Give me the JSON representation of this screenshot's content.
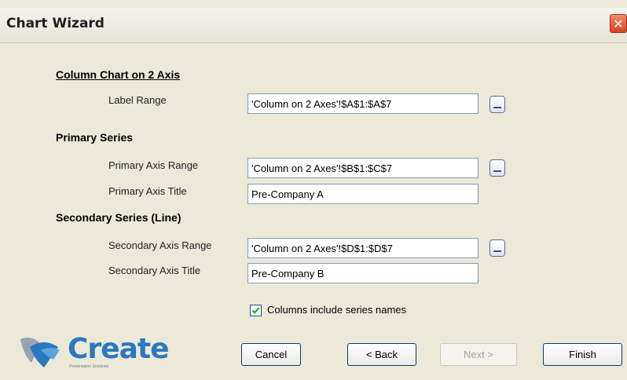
{
  "window": {
    "title": "Chart Wizard",
    "close_glyph": "✕"
  },
  "sections": {
    "chart_type": "Column Chart on 2 Axis",
    "primary": "Primary Series",
    "secondary": "Secondary Series (Line)"
  },
  "fields": {
    "label_range": {
      "label": "Label Range",
      "value": "'Column on 2 Axes'!$A$1:$A$7"
    },
    "primary_range": {
      "label": "Primary Axis Range",
      "value": "'Column on 2 Axes'!$B$1:$C$7"
    },
    "primary_title": {
      "label": "Primary Axis Title",
      "value": "Pre-Company A"
    },
    "secondary_range": {
      "label": "Secondary Axis Range",
      "value": "'Column on 2 Axes'!$D$1:$D$7"
    },
    "secondary_title": {
      "label": "Secondary Axis Title",
      "value": "Pre-Company B"
    }
  },
  "checkbox": {
    "label": "Columns include series names",
    "checked": true
  },
  "buttons": {
    "cancel": "Cancel",
    "back": "< Back",
    "next": "Next >",
    "finish": "Finish"
  },
  "logo": {
    "text": "Create",
    "tagline": "Presentation Solutions"
  },
  "icons": {
    "close": "close-icon",
    "range_picker": "range-select-icon",
    "check": "checkmark-icon",
    "logo_mark": "create-logo-icon"
  },
  "colors": {
    "accent": "#2a78c0",
    "close": "#d4431f",
    "field_border": "#7f9db9"
  }
}
